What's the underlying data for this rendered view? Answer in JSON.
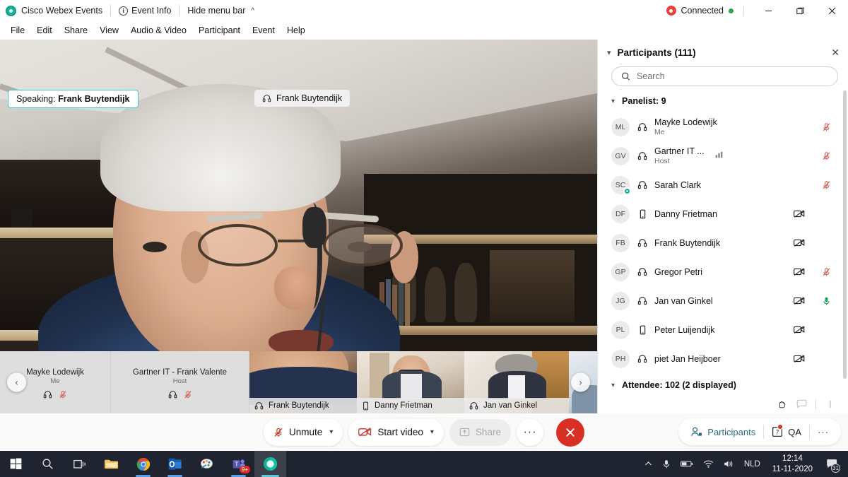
{
  "titlebar": {
    "app_name": "Cisco Webex Events",
    "event_info": "Event Info",
    "hide_menu": "Hide menu bar",
    "connection_status": "Connected",
    "minimize": "—",
    "maximize": "❐",
    "close": "✕"
  },
  "menubar": {
    "items": [
      {
        "label": "File"
      },
      {
        "label": "Edit"
      },
      {
        "label": "Share"
      },
      {
        "label": "View"
      },
      {
        "label": "Audio & Video"
      },
      {
        "label": "Participant"
      },
      {
        "label": "Event"
      },
      {
        "label": "Help"
      }
    ]
  },
  "stage": {
    "speaking_prefix": "Speaking: ",
    "speaking_name": "Frank Buytendijk",
    "active_name": "Frank Buytendijk",
    "nav_prev": "‹",
    "nav_next": "›"
  },
  "filmstrip": {
    "thumbs": [
      {
        "name": "Mayke Lodewijk",
        "role": "Me",
        "has_video": false,
        "device": "headset",
        "muted": true,
        "active": false
      },
      {
        "name": "Gartner IT - Frank Valente",
        "role": "Host",
        "has_video": false,
        "device": "headset",
        "muted": true,
        "active": false
      },
      {
        "name": "Frank Buytendijk",
        "role": "",
        "has_video": true,
        "device": "headset",
        "muted": false,
        "active": false
      },
      {
        "name": "Danny Frietman",
        "role": "",
        "has_video": true,
        "device": "mobile",
        "muted": false,
        "active": false
      },
      {
        "name": "Jan van Ginkel",
        "role": "",
        "has_video": true,
        "device": "headset",
        "muted": false,
        "active": true
      }
    ]
  },
  "panel": {
    "title": "Participants (111)",
    "close_label": "✕",
    "search_placeholder": "Search",
    "search_value": "",
    "panelist_group": "Panelist: 9",
    "attendee_group": "Attendee: 102 (2 displayed)",
    "participants": [
      {
        "initials": "ML",
        "name": "Mayke Lodewijk",
        "role": "Me",
        "device": "headset",
        "mic": "muted",
        "video": false,
        "activity": false,
        "presence": false
      },
      {
        "initials": "GV",
        "name": "Gartner IT ...",
        "role": "Host",
        "device": "headset",
        "mic": "muted",
        "video": false,
        "activity": true,
        "presence": false
      },
      {
        "initials": "SC",
        "name": "Sarah Clark",
        "role": "",
        "device": "headset",
        "mic": "muted",
        "video": false,
        "activity": false,
        "presence": true
      },
      {
        "initials": "DF",
        "name": "Danny Frietman",
        "role": "",
        "device": "mobile",
        "mic": "none",
        "video": true,
        "activity": false,
        "presence": false
      },
      {
        "initials": "FB",
        "name": "Frank Buytendijk",
        "role": "",
        "device": "headset",
        "mic": "none",
        "video": true,
        "activity": false,
        "presence": false
      },
      {
        "initials": "GP",
        "name": "Gregor Petri",
        "role": "",
        "device": "headset",
        "mic": "muted",
        "video": true,
        "activity": false,
        "presence": false
      },
      {
        "initials": "JG",
        "name": "Jan van Ginkel",
        "role": "",
        "device": "headset",
        "mic": "active",
        "video": true,
        "activity": false,
        "presence": false
      },
      {
        "initials": "PL",
        "name": "Peter Luijendijk",
        "role": "",
        "device": "mobile",
        "mic": "none",
        "video": true,
        "activity": false,
        "presence": false
      },
      {
        "initials": "PH",
        "name": "piet Jan Heijboer",
        "role": "",
        "device": "headset",
        "mic": "none",
        "video": true,
        "activity": false,
        "presence": false
      }
    ]
  },
  "controls": {
    "unmute_label": "Unmute",
    "start_video_label": "Start video",
    "share_label": "Share",
    "more_label": "···",
    "end_label": "✕",
    "participants_label": "Participants",
    "qa_label": "QA",
    "right_more_label": "···",
    "caret": "⌄"
  },
  "taskbar": {
    "apps": [
      {
        "name": "start"
      },
      {
        "name": "search"
      },
      {
        "name": "task-view"
      },
      {
        "name": "file-explorer"
      },
      {
        "name": "chrome"
      },
      {
        "name": "outlook"
      },
      {
        "name": "paint"
      },
      {
        "name": "teams",
        "badge": "9+"
      },
      {
        "name": "webex"
      }
    ],
    "language": "NLD",
    "time": "12:14",
    "date": "11-11-2020",
    "calendar_day": "31"
  },
  "colors": {
    "accent_teal": "#0fb39a",
    "active_border": "#2bb3d6",
    "mute_red": "#c0392b",
    "end_red": "#d93025",
    "link_teal": "#2a6c7d",
    "green": "#2ea64b",
    "taskbar_bg": "#1f2430"
  }
}
